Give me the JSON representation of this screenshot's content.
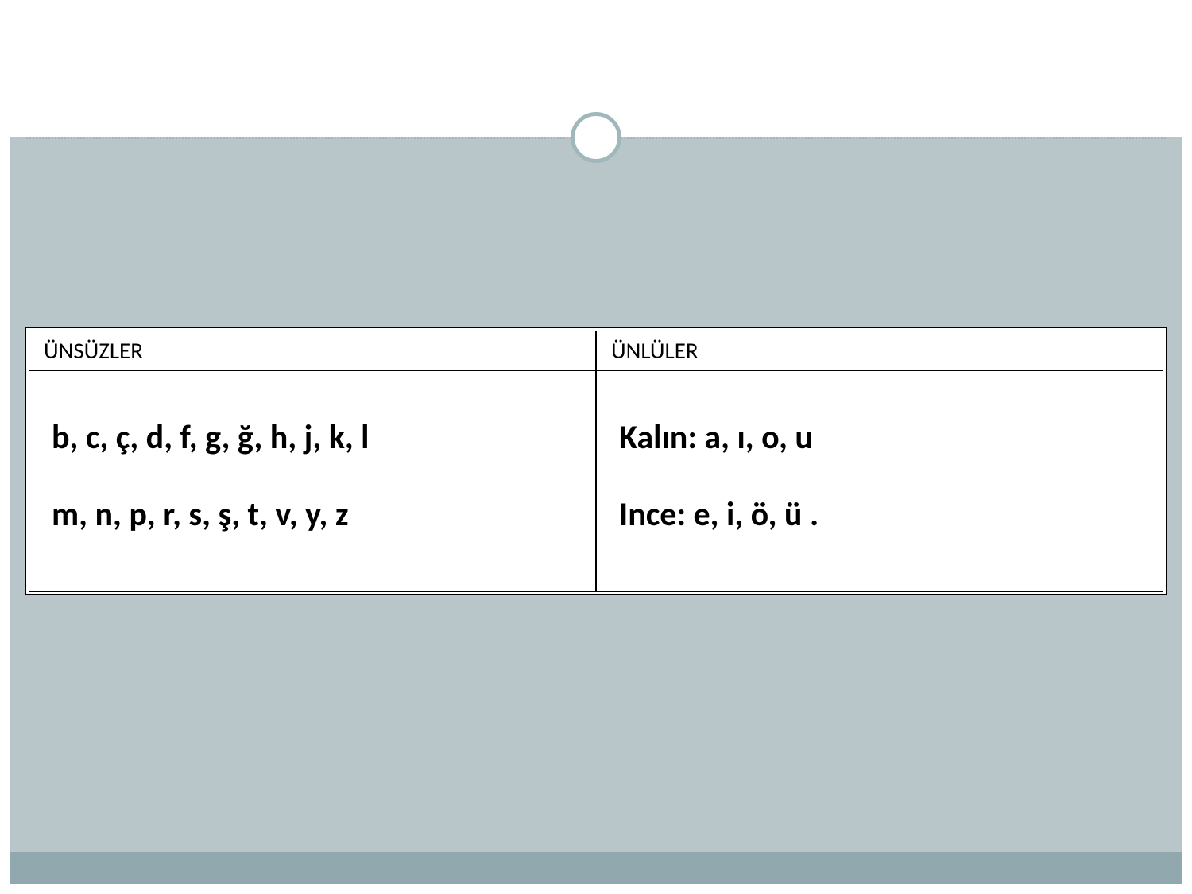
{
  "table": {
    "headers": {
      "left": "ÜNSÜZLER",
      "right": "ÜNLÜLER"
    },
    "body": {
      "left_line1": "b, c, ç, d, f, g, ğ, h, j, k, l",
      "left_line2": "m, n, p, r, s, ş, t, v, y, z",
      "right_line1": "Kalın:   a, ı, o, u",
      "right_line2": "Ince:   e, i, ö, ü ."
    }
  }
}
